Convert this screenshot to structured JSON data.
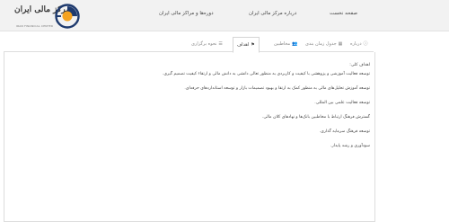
{
  "logo": {
    "text": "مرکز مالی ایران",
    "subtitle": "IRAN FINANCIAL CENTER",
    "brand_color": "#1e3a6e",
    "accent_color": "#f4a21f"
  },
  "nav": {
    "home": "صفحه نخست",
    "about": "درباره مرکز مالی ایران",
    "courses": "دوره‌ها و مراکز مالی ایران"
  },
  "tabs": [
    {
      "label": "درباره",
      "icon": "info-icon"
    },
    {
      "label": "جدول زمان بندی",
      "icon": "calendar-icon"
    },
    {
      "label": "مخاطبین",
      "icon": "users-icon"
    },
    {
      "label": "اهداف",
      "icon": "flag-icon",
      "active": true
    },
    {
      "label": "نحوه برگزاری",
      "icon": "list-icon"
    }
  ],
  "content": {
    "heading": "اهداف کلی:",
    "paragraphs": [
      "توسعه فعالیت آموزشی و پژوهشی با کیفیت و کاربردی به منظور تعالی دانشی به دانش مالی و ارتقاء کیفیت تصمیم گیری.",
      "توسعه آموزش تحلیل‌های مالی به منظور کمک به ارتقا و بهبود تصمیمات بازار و توسعه استانداردهای حرفه‌ای.",
      "توسعه فعالیت علمی بین المللی.",
      "گسترش فرهنگ ارتباط با مخاطبین بانک‌ها و نهادهای کلان مالی.",
      "توسعه فرهنگ سرمایه گذاری.",
      "سودآوری و رشد پایدار."
    ]
  }
}
